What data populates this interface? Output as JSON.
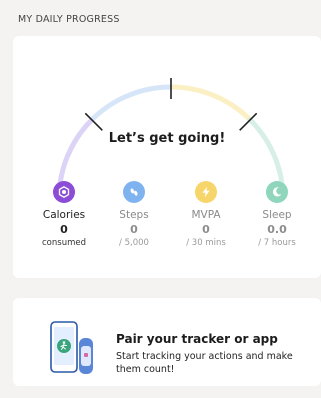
{
  "section_title": "MY DAILY PROGRESS",
  "progress": {
    "headline": "Let’s get going!",
    "metrics": [
      {
        "name": "Calories",
        "icon": "calories-icon",
        "color": "#8b4cd6",
        "value": "0",
        "sub": "consumed"
      },
      {
        "name": "Steps",
        "icon": "footsteps-icon",
        "color": "#7fb3ef",
        "value": "0",
        "sub": "/ 5,000"
      },
      {
        "name": "MVPA",
        "icon": "lightning-icon",
        "color": "#f6d66a",
        "value": "0",
        "sub": "/ 30 mins"
      },
      {
        "name": "Sleep",
        "icon": "moon-icon",
        "color": "#8fd6bd",
        "value": "0.0",
        "sub": "/ 7 hours"
      }
    ]
  },
  "tracker": {
    "title": "Pair your tracker or app",
    "description": "Start tracking your actions and make them count!",
    "illustration_icon": "phone-tracker-icon"
  },
  "colors": {
    "background": "#f4f3f1",
    "card": "#ffffff",
    "arc_calories": "#dcd3f6",
    "arc_steps": "#d6e6f8",
    "arc_mvpa": "#fbefc4",
    "arc_sleep": "#d7efe6"
  }
}
